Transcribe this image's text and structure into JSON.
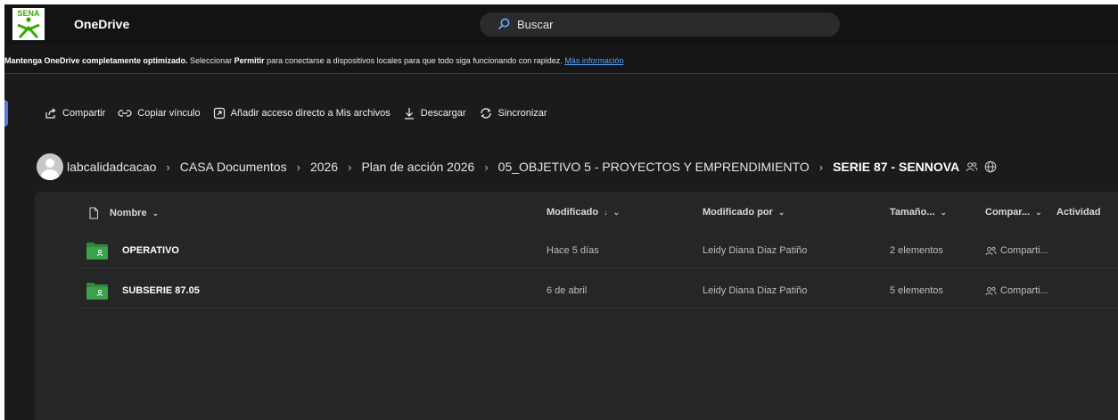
{
  "header": {
    "logo_text": "SENA",
    "app_title": "OneDrive",
    "search_placeholder": "Buscar"
  },
  "notice": {
    "bold1": "Mantenga OneDrive completamente optimizado.",
    "text1": " Seleccionar ",
    "bold2": "Permitir",
    "text2": " para conectarse a dispositivos locales para que todo siga funcionando con rapidez. ",
    "link": "Más información"
  },
  "commands": [
    {
      "label": "Compartir",
      "icon": "share-icon"
    },
    {
      "label": "Copiar vínculo",
      "icon": "link-icon"
    },
    {
      "label": "Añadir acceso directo a Mis archivos",
      "icon": "shortcut-icon"
    },
    {
      "label": "Descargar",
      "icon": "download-icon"
    },
    {
      "label": "Sincronizar",
      "icon": "sync-icon"
    }
  ],
  "breadcrumb": [
    "labcalidadcacao",
    "CASA Documentos",
    "2026",
    "Plan de acción 2026",
    "05_OBJETIVO 5 - PROYECTOS Y EMPRENDIMIENTO",
    "SERIE 87 - SENNOVA"
  ],
  "columns": {
    "name": "Nombre",
    "modified": "Modificado",
    "modified_by": "Modificado por",
    "size": "Tamaño...",
    "sharing": "Compar...",
    "activity": "Actividad"
  },
  "rows": [
    {
      "name": "OPERATIVO",
      "modified": "Hace 5 días",
      "modified_by": "Leidy Diana Diaz Patiño",
      "size": "2 elementos",
      "sharing": "Comparti..."
    },
    {
      "name": "SUBSERIE 87.05",
      "modified": "6 de abril",
      "modified_by": "Leidy Diana Diaz Patiño",
      "size": "5 elementos",
      "sharing": "Comparti..."
    }
  ],
  "colors": {
    "accent_link": "#4ea6ff",
    "folder_green": "#2e8b3e",
    "sena_green": "#39a900"
  }
}
